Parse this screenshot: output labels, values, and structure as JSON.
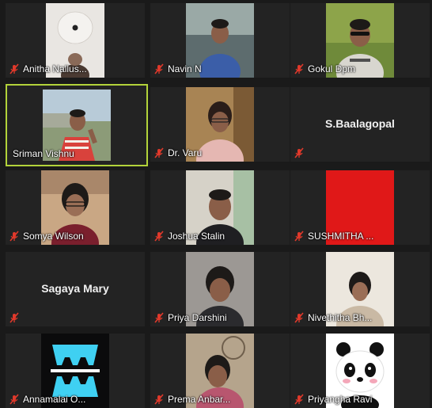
{
  "participants": [
    {
      "name": "Anitha Nallus...",
      "muted": true
    },
    {
      "name": "Navin N",
      "muted": true
    },
    {
      "name": "Gokul Dpm",
      "muted": true
    },
    {
      "name": "Sriman Vishnu",
      "muted": false,
      "speaking": true
    },
    {
      "name": "Dr. Varu",
      "muted": true
    },
    {
      "name": "S.Baalagopal",
      "muted": true,
      "video_off": true
    },
    {
      "name": "Somya Wilson",
      "muted": true
    },
    {
      "name": "Joshua Stalin",
      "muted": true
    },
    {
      "name": "SUSHMITHA ...",
      "muted": true
    },
    {
      "name": "Sagaya Mary",
      "muted": true,
      "video_off": true
    },
    {
      "name": "Priya Darshini",
      "muted": true
    },
    {
      "name": "Nivethitha Bh...",
      "muted": true
    },
    {
      "name": "Annamalai O...",
      "muted": true
    },
    {
      "name": "Prema Anbar...",
      "muted": true
    },
    {
      "name": "Priyangha Ravi",
      "muted": true
    }
  ],
  "colors": {
    "active_border": "#b3d33a",
    "muted_icon": "#e0392b",
    "tile_bg": "#232323",
    "page_bg": "#1a1a1a"
  }
}
